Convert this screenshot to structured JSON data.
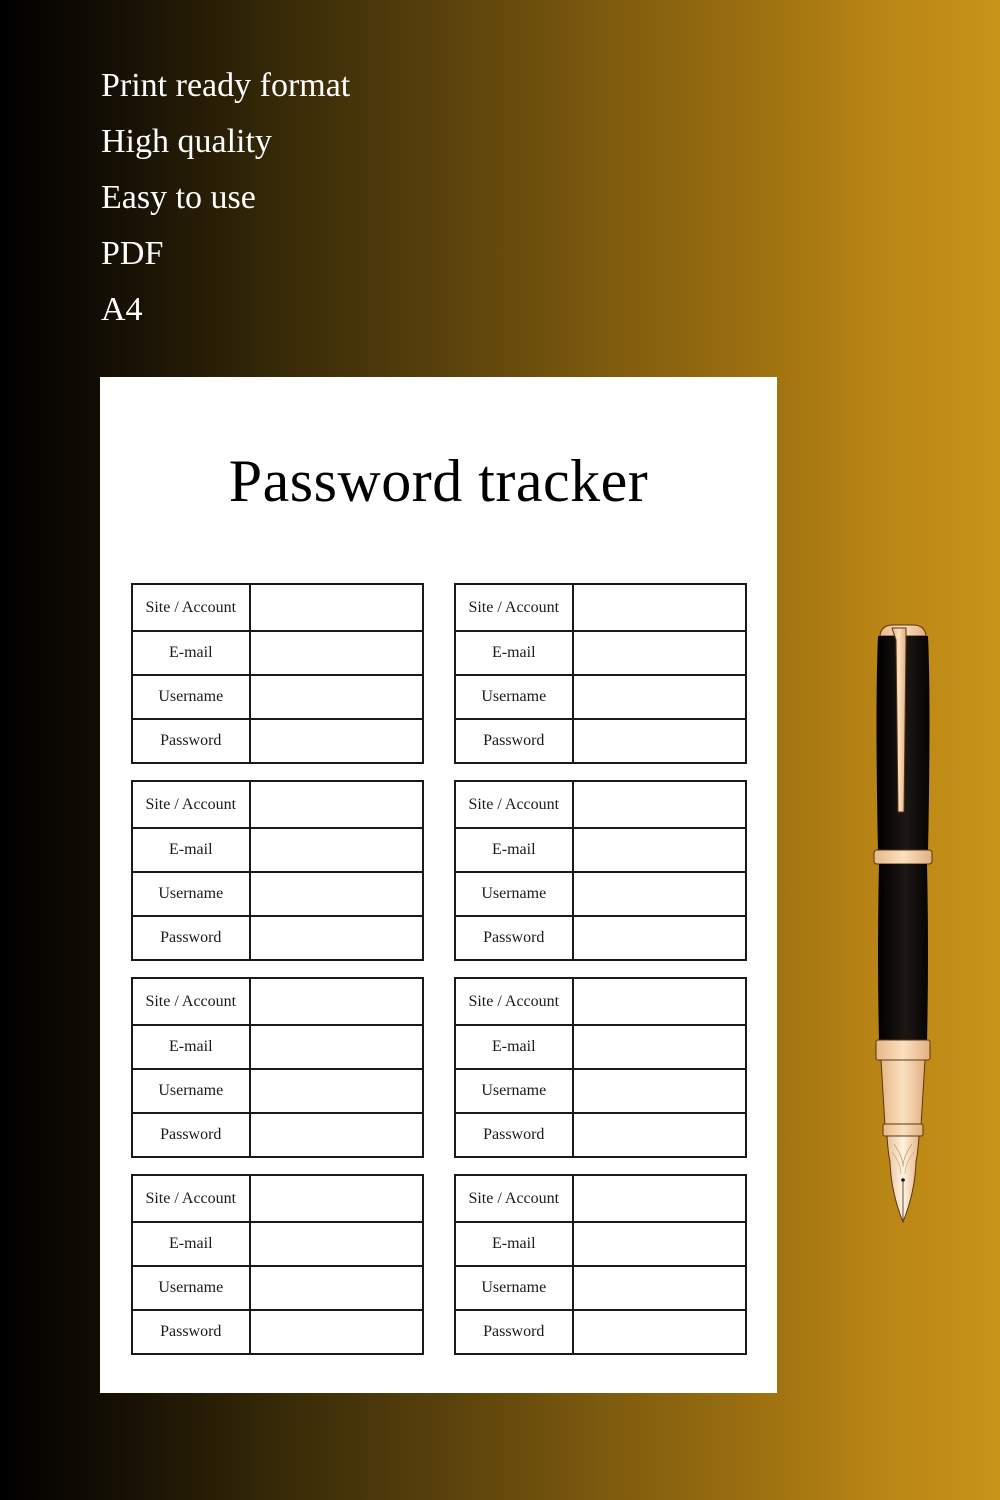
{
  "features": [
    "Print ready format",
    "High quality",
    "Easy to use",
    "PDF",
    "A4"
  ],
  "sheet": {
    "title": "Password tracker",
    "field_labels": [
      "Site / Account",
      "E-mail",
      "Username",
      "Password"
    ],
    "entries": [
      {
        "site": "",
        "email": "",
        "username": "",
        "password": ""
      },
      {
        "site": "",
        "email": "",
        "username": "",
        "password": ""
      },
      {
        "site": "",
        "email": "",
        "username": "",
        "password": ""
      },
      {
        "site": "",
        "email": "",
        "username": "",
        "password": ""
      },
      {
        "site": "",
        "email": "",
        "username": "",
        "password": ""
      },
      {
        "site": "",
        "email": "",
        "username": "",
        "password": ""
      },
      {
        "site": "",
        "email": "",
        "username": "",
        "password": ""
      },
      {
        "site": "",
        "email": "",
        "username": "",
        "password": ""
      }
    ]
  },
  "decoration": {
    "icon": "fountain-pen-icon",
    "colors": {
      "gradient_start": "#000000",
      "gradient_end": "#c99419",
      "pen_body": "#111111",
      "pen_trim": "#f1c79a"
    }
  }
}
